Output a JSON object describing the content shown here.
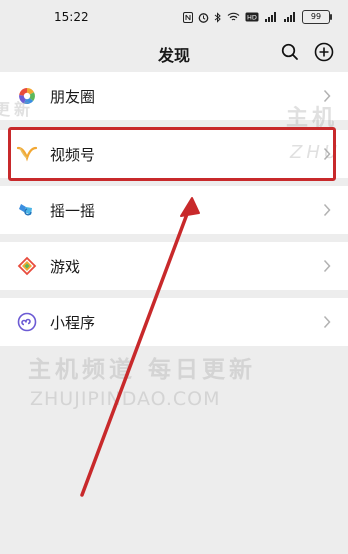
{
  "status_bar": {
    "time": "15:22",
    "battery": "99",
    "icons": [
      "nfc-icon",
      "alarm-icon",
      "bluetooth-icon",
      "wifi-icon",
      "hd-icon",
      "signal-icon",
      "signal-icon-2",
      "battery-icon"
    ]
  },
  "header": {
    "title": "发现",
    "search_icon": "search-icon",
    "add_icon": "add-circle-icon"
  },
  "menu": [
    {
      "label": "朋友圈",
      "icon": "moments-icon"
    },
    {
      "label": "视频号",
      "icon": "channels-icon",
      "highlighted": true
    },
    {
      "label": "摇一摇",
      "icon": "shake-icon"
    },
    {
      "label": "游戏",
      "icon": "games-icon"
    },
    {
      "label": "小程序",
      "icon": "mini-programs-icon"
    }
  ],
  "watermark": {
    "chinese": "主机频道 每日更新",
    "latin": "ZHUJIPINDAO.COM",
    "partial_top_right_cn": "主机",
    "partial_top_right_en": "ZHU",
    "partial_top_left_cn": "更新"
  },
  "colors": {
    "background": "#ededed",
    "list_bg": "#ffffff",
    "annotation_red": "#c8292b",
    "text": "#191919"
  }
}
